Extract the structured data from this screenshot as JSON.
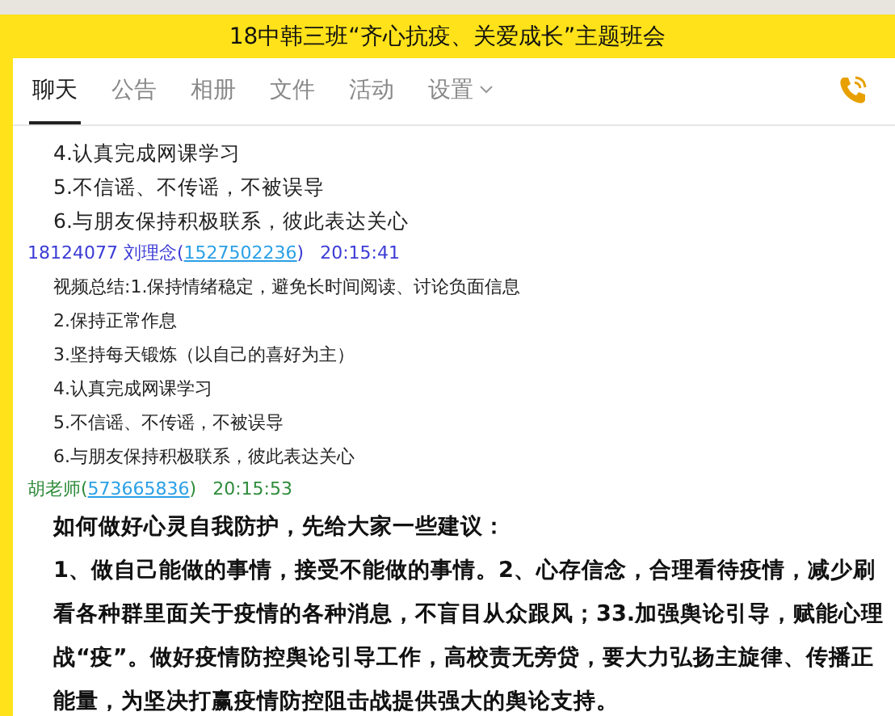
{
  "window": {
    "title": "18中韩三班“齐心抗疫、关爱成长”主题班会"
  },
  "tabs": [
    {
      "label": "聊天",
      "selected": true,
      "dropdown": false
    },
    {
      "label": "公告",
      "selected": false,
      "dropdown": false
    },
    {
      "label": "相册",
      "selected": false,
      "dropdown": false
    },
    {
      "label": "文件",
      "selected": false,
      "dropdown": false
    },
    {
      "label": "活动",
      "selected": false,
      "dropdown": false
    },
    {
      "label": "设置",
      "selected": false,
      "dropdown": true
    }
  ],
  "messages": [
    {
      "kind": "large",
      "lines": [
        "4.认真完成网课学习",
        "5.不信谣、不传谣，不被误导",
        "6.与朋友保持积极联系，彼此表达关心"
      ]
    },
    {
      "kind": "small",
      "sender": "18124077 刘理念",
      "open": "(",
      "contact": "1527502236",
      "close": ")",
      "time": "20:15:41",
      "color": "#3b3bd6",
      "lines": [
        "视频总结:1.保持情绪稳定，避免长时间阅读、讨论负面信息",
        "2.保持正常作息",
        "3.坚持每天锻炼（以自己的喜好为主）",
        "4.认真完成网课学习",
        "5.不信谣、不传谣，不被误导",
        "6.与朋友保持积极联系，彼此表达关心"
      ]
    },
    {
      "kind": "bold",
      "sender": "胡老师",
      "open": "(",
      "contact": "573665836",
      "close": ")",
      "time": "20:15:53",
      "color": "#2e8b3a",
      "lines": [
        "如何做好心灵自我防护，先给大家一些建议：",
        "1、做自己能做的事情，接受不能做的事情。2、心存信念，合理看待疫情，减少刷看各种群里面关于疫情的各种消息，不盲目从众跟风；33.加强舆论引导，赋能心理战“疫”。做好疫情防控舆论引导工作，高校责无旁贷，要大力弘扬主旋律、传播正能量，为坚决打赢疫情防控阻击战提供强大的舆论支持。"
      ]
    }
  ]
}
